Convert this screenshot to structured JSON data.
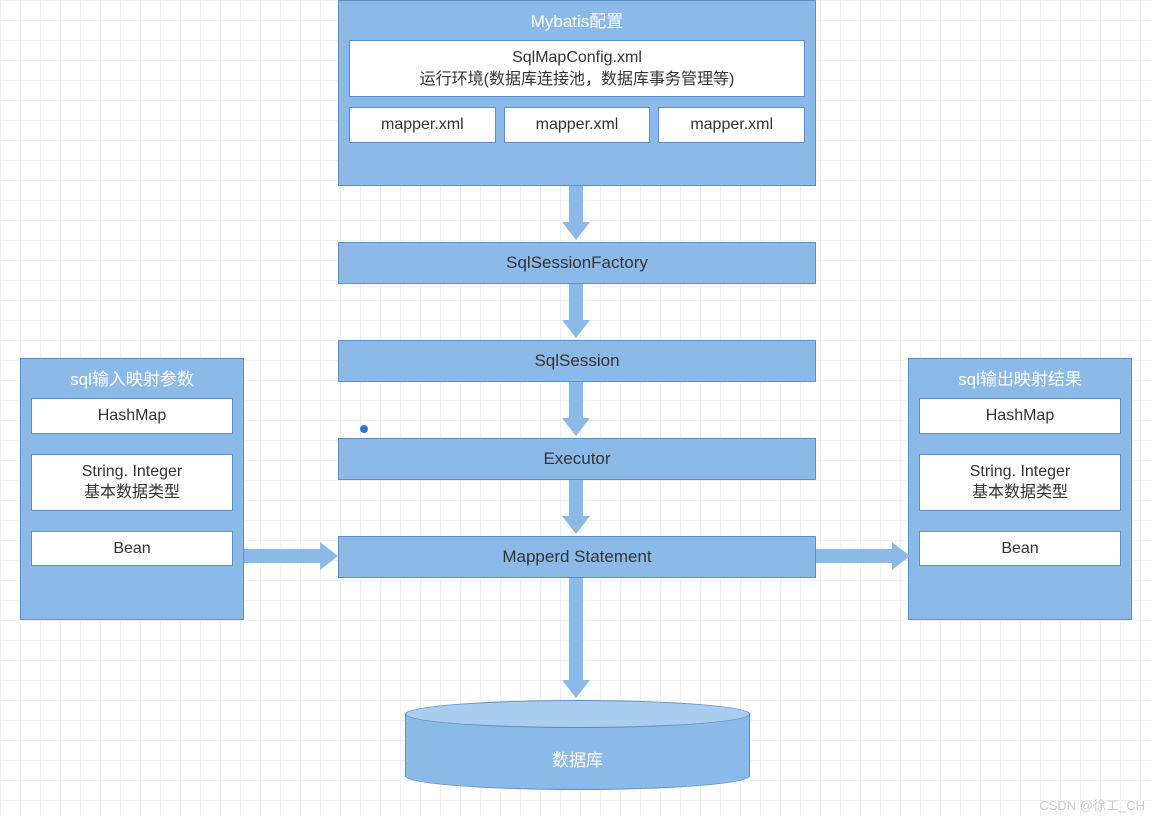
{
  "top_panel": {
    "title": "Mybatis配置",
    "config": {
      "line1": "SqlMapConfig.xml",
      "line2": "运行环境(数据库连接池，数据库事务管理等)"
    },
    "mappers": [
      "mapper.xml",
      "mapper.xml",
      "mapper.xml"
    ]
  },
  "flow": {
    "step1": "SqlSessionFactory",
    "step2": "SqlSession",
    "step3": "Executor",
    "step4": "Mapperd Statement"
  },
  "left_panel": {
    "title": "sql输入映射参数",
    "items": [
      {
        "text": "HashMap"
      },
      {
        "line1": "String. Integer",
        "line2": "基本数据类型"
      },
      {
        "text": "Bean"
      }
    ]
  },
  "right_panel": {
    "title": "sql输出映射结果",
    "items": [
      {
        "text": "HashMap"
      },
      {
        "line1": "String. Integer",
        "line2": "基本数据类型"
      },
      {
        "text": "Bean"
      }
    ]
  },
  "database": "数据库",
  "watermark": "CSDN @徐工_CH"
}
